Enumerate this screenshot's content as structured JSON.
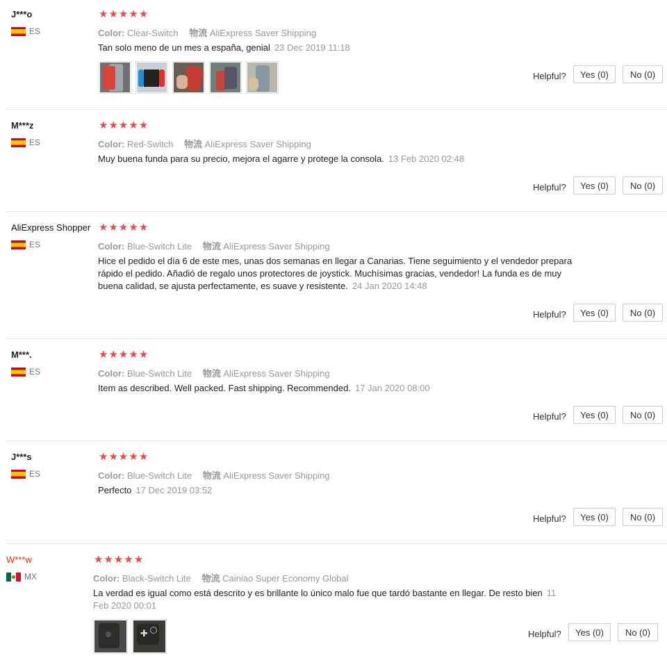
{
  "labels": {
    "color": "Color:",
    "logistics": "物流",
    "helpful": "Helpful?"
  },
  "star_count": 5,
  "star_color": "#f04848",
  "reviews": [
    {
      "user": "J***o",
      "country": "ES",
      "flag": "spain-flag-icon",
      "color": "Clear-Switch",
      "shipping": "AliExpress Saver Shipping",
      "text": "Tan solo meno de un mes a españa, genial",
      "date": "23 Dec 2019 11:18",
      "yes": "Yes (0)",
      "no": "No (0)"
    },
    {
      "user": "M***z",
      "country": "ES",
      "flag": "spain-flag-icon",
      "color": "Red-Switch",
      "shipping": "AliExpress Saver Shipping",
      "text": "Muy buena funda para su precio, mejora el agarre y protege la consola.",
      "date": "13 Feb 2020 02:48",
      "yes": "Yes (0)",
      "no": "No (0)"
    },
    {
      "user": "AliExpress Shopper",
      "country": "ES",
      "flag": "spain-flag-icon",
      "color": "Blue-Switch Lite",
      "shipping": "AliExpress Saver Shipping",
      "text_lines": [
        "Hice el pedido el día 6 de este mes, unas dos semanas en llegar a Canarias. Tiene seguimiento y el vendedor prepara",
        "rápido el pedido. Añadió de regalo unos protectores de joystick. Muchísimas gracias, vendedor! La funda es de muy",
        "buena calidad, se ajusta perfectamente, es suave y resistente."
      ],
      "date": "24 Jan 2020 14:48",
      "yes": "Yes (0)",
      "no": "No (0)"
    },
    {
      "user": "M***.",
      "country": "ES",
      "flag": "spain-flag-icon",
      "color": "Blue-Switch Lite",
      "shipping": "AliExpress Saver Shipping",
      "text": "Item as described. Well packed. Fast shipping. Recommended.",
      "date": "17 Jan 2020 08:00",
      "yes": "Yes (0)",
      "no": "No (0)"
    },
    {
      "user": "J***s",
      "country": "ES",
      "flag": "spain-flag-icon",
      "color": "Blue-Switch Lite",
      "shipping": "AliExpress Saver Shipping",
      "text": "Perfecto",
      "date": "17 Dec 2019 03:52",
      "yes": "Yes (0)",
      "no": "No (0)"
    },
    {
      "user": "W***w",
      "country": "MX",
      "flag": "mexico-flag-icon",
      "color": "Black-Switch Lite",
      "shipping": "Cainiao Super Economy Global",
      "text": "La verdad es igual como está descrito y es brillante lo único malo fue que tardó bastante en llegar. De resto bien",
      "date_part1": "11",
      "date_part2": "Feb 2020 00:01",
      "yes": "Yes (0)",
      "no": "No (0)"
    }
  ]
}
